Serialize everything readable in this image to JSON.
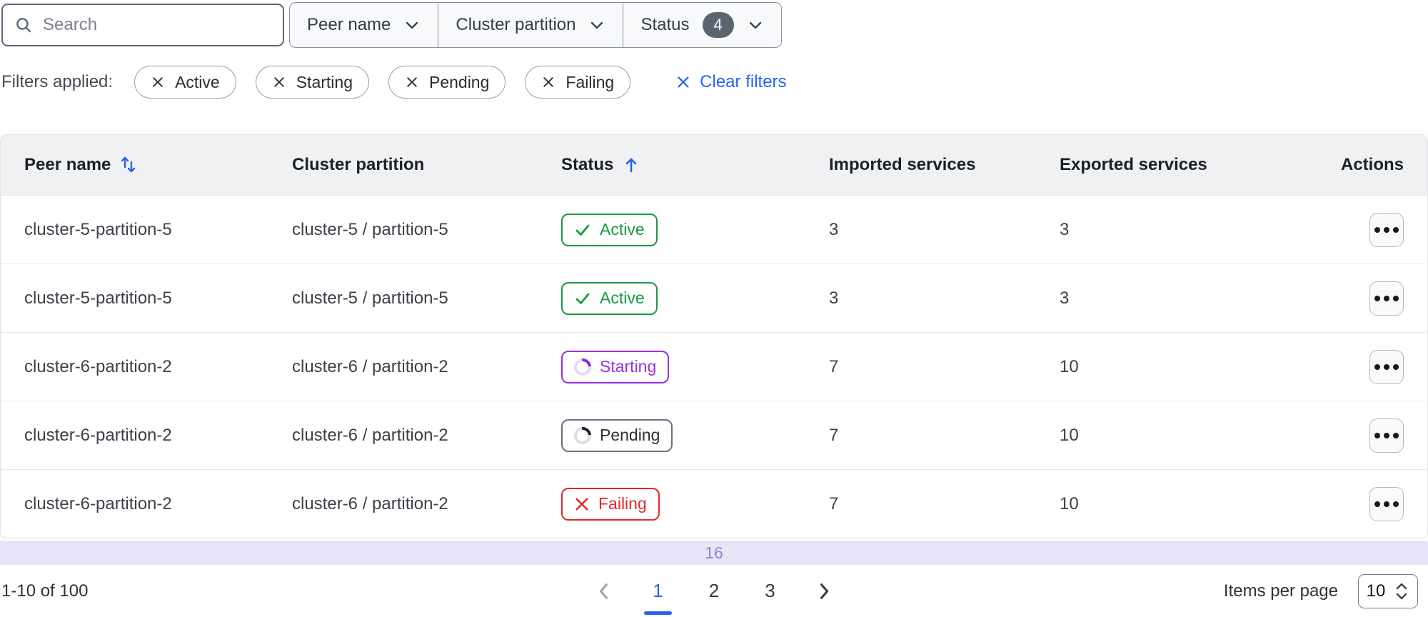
{
  "toolbar": {
    "search": {
      "placeholder": "Search"
    },
    "dropdowns": [
      {
        "label": "Peer name"
      },
      {
        "label": "Cluster partition"
      },
      {
        "label": "Status",
        "badge": "4"
      }
    ]
  },
  "filters": {
    "label": "Filters applied:",
    "chips": [
      {
        "label": "Active"
      },
      {
        "label": "Starting"
      },
      {
        "label": "Pending"
      },
      {
        "label": "Failing"
      }
    ],
    "clear_label": "Clear filters"
  },
  "table": {
    "columns": [
      "Peer name",
      "Cluster partition",
      "Status",
      "Imported services",
      "Exported services",
      "Actions"
    ],
    "sort": {
      "peer_name": "unsorted-both-arrows",
      "status": "ascending-arrow"
    },
    "rows": [
      {
        "peer": "cluster-5-partition-5",
        "partition": "cluster-5 / partition-5",
        "status": "Active",
        "imported": "3",
        "exported": "3"
      },
      {
        "peer": "cluster-5-partition-5",
        "partition": "cluster-5 / partition-5",
        "status": "Active",
        "imported": "3",
        "exported": "3"
      },
      {
        "peer": "cluster-6-partition-2",
        "partition": "cluster-6 / partition-2",
        "status": "Starting",
        "imported": "7",
        "exported": "10"
      },
      {
        "peer": "cluster-6-partition-2",
        "partition": "cluster-6 / partition-2",
        "status": "Pending",
        "imported": "7",
        "exported": "10"
      },
      {
        "peer": "cluster-6-partition-2",
        "partition": "cluster-6 / partition-2",
        "status": "Failing",
        "imported": "7",
        "exported": "10"
      }
    ],
    "indicator_value": "16"
  },
  "pagination": {
    "range_text": "1-10 of 100",
    "pages": [
      "1",
      "2",
      "3"
    ],
    "current_page": "1",
    "items_per_page_label": "Items per page",
    "items_per_page_value": "10"
  },
  "colors": {
    "accent_blue": "#2563eb",
    "status_active_green": "#179a3d",
    "status_starting_purple": "#9b2de8",
    "status_pending_gray": "#697180",
    "status_failing_red": "#dd2b2b",
    "badge_count_bg": "#5b6570",
    "indicator_bar_bg": "#e7e5f7",
    "table_header_bg": "#f0f1f3"
  }
}
